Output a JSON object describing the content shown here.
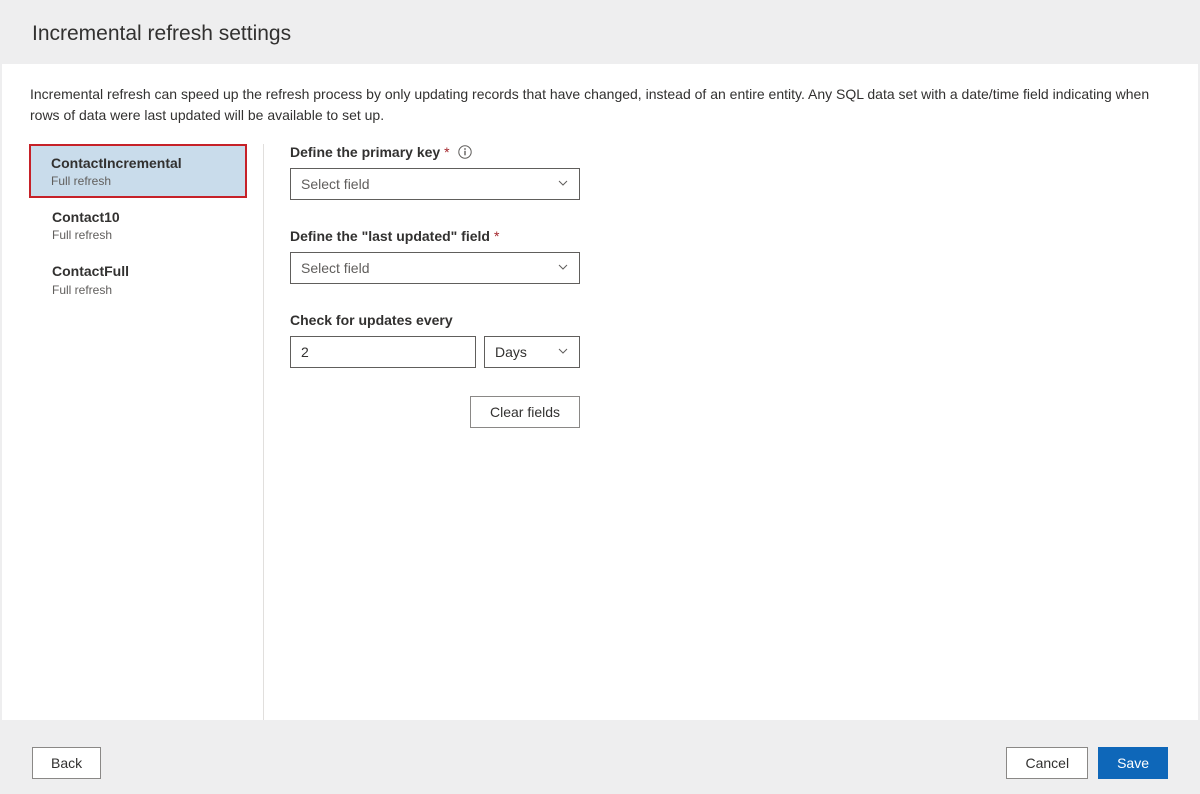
{
  "header": {
    "title": "Incremental refresh settings"
  },
  "description": "Incremental refresh can speed up the refresh process by only updating records that have changed, instead of an entire entity. Any SQL data set with a date/time field indicating when rows of data were last updated will be available to set up.",
  "sidebar": {
    "items": [
      {
        "name": "ContactIncremental",
        "sub": "Full refresh",
        "selected": true
      },
      {
        "name": "Contact10",
        "sub": "Full refresh",
        "selected": false
      },
      {
        "name": "ContactFull",
        "sub": "Full refresh",
        "selected": false
      }
    ]
  },
  "form": {
    "primary_key": {
      "label": "Define the primary key",
      "placeholder": "Select field"
    },
    "last_updated": {
      "label": "Define the \"last updated\" field",
      "placeholder": "Select field"
    },
    "check_updates": {
      "label": "Check for updates every",
      "value": "2",
      "unit": "Days"
    },
    "clear_label": "Clear fields"
  },
  "footer": {
    "back": "Back",
    "cancel": "Cancel",
    "save": "Save"
  }
}
